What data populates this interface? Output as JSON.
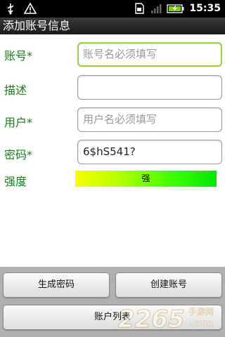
{
  "status_bar": {
    "time": "15:35",
    "icons": [
      "usb-icon",
      "warning-icon",
      "sim-icon",
      "signal-icon",
      "battery-icon"
    ]
  },
  "title_bar": {
    "title": "添加账号信息"
  },
  "form": {
    "account_label": "账号*",
    "account_placeholder": "账号名必须填写",
    "desc_label": "描述",
    "desc_value": "",
    "user_label": "用户*",
    "user_placeholder": "用户名必须填写",
    "password_label": "密码*",
    "password_value": "6$hS541?",
    "strength_label": "强度",
    "strength_value": "强"
  },
  "buttons": {
    "generate_password": "生成密码",
    "create_account": "创建账号",
    "account_list": "账户列表"
  },
  "watermark": {
    "brand_number": "2265",
    "brand_suffix": "手游网",
    "brand_domain": ".com"
  },
  "colors": {
    "label_green": "#1d7a1d",
    "focus_border": "#9ccf3c",
    "status_bar_bg": "#000000",
    "bottom_panel_bg": "#b0b0b0"
  }
}
